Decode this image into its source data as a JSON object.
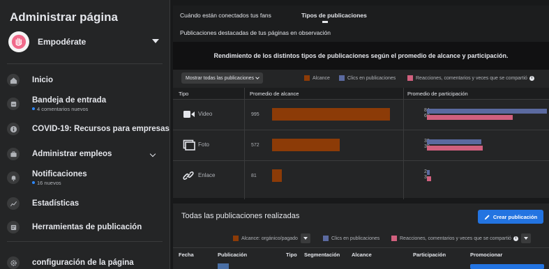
{
  "sidebar": {
    "title": "Administrar página",
    "page_name": "Empodérate",
    "items": [
      {
        "label": "Inicio",
        "sub": ""
      },
      {
        "label": "Bandeja de entrada",
        "sub": "4 comentarios nuevos"
      },
      {
        "label": "COVID-19: Recursos para empresas",
        "sub": ""
      },
      {
        "label": "Administrar empleos",
        "sub": ""
      },
      {
        "label": "Notificaciones",
        "sub": "16 nuevos"
      },
      {
        "label": "Estadísticas",
        "sub": ""
      },
      {
        "label": "Herramientas de publicación",
        "sub": ""
      },
      {
        "label": "configuración de la página",
        "sub": ""
      }
    ]
  },
  "tabs": {
    "when_fans_online": "Cuándo están conectados tus fans",
    "post_types": "Tipos de publicaciones",
    "featured_posts": "Publicaciones destacadas de tus páginas en observación"
  },
  "perf": {
    "heading": "Rendimiento de los distintos tipos de publicaciones según el promedio de alcance y participación.",
    "filter_label": "Mostrar todas las publicaciones",
    "legend": {
      "reach": "Alcance",
      "clicks": "Clics en publicaciones",
      "reactions": "Reacciones, comentarios y veces que se compartió"
    },
    "columns": {
      "type": "Tipo",
      "avg_reach": "Promedio de alcance",
      "avg_engagement": "Promedio de participación"
    },
    "colors": {
      "reach": "#8c3b07",
      "clicks": "#5b6aa0",
      "reactions": "#d1607e"
    }
  },
  "chart_data": {
    "type": "bar",
    "categories": [
      "Video",
      "Foto",
      "Enlace"
    ],
    "series": [
      {
        "name": "Alcance",
        "values": [
          995,
          572,
          81
        ]
      },
      {
        "name": "Clics en publicaciones",
        "values": [
          84,
          38,
          2
        ]
      },
      {
        "name": "Reacciones, comentarios y veces que se compartió",
        "values": [
          60,
          39,
          3
        ]
      }
    ]
  },
  "all_posts": {
    "title": "Todas las publicaciones realizadas",
    "create_label": "Crear publicación",
    "legend": {
      "reach": "Alcance: orgánico/pagado",
      "clicks": "Clics en publicaciones",
      "reactions": "Reacciones, comentarios y veces que se compartió"
    },
    "columns": {
      "date": "Fecha",
      "post": "Publicación",
      "type": "Tipo",
      "targeting": "Segmentación",
      "reach": "Alcance",
      "engagement": "Participación",
      "promote": "Promocionar"
    }
  }
}
